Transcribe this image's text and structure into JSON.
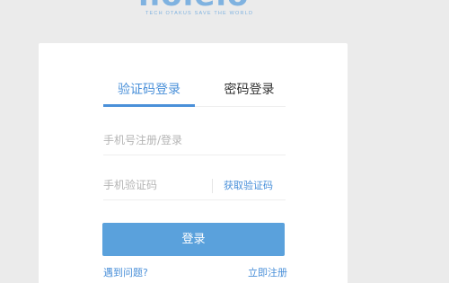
{
  "brand": {
    "logo_text": "ilolelo",
    "tagline": "TECH OTAKUS SAVE THE WORLD"
  },
  "login": {
    "tabs": [
      {
        "label": "验证码登录",
        "active": true
      },
      {
        "label": "密码登录",
        "active": false
      }
    ],
    "phone_placeholder": "手机号注册/登录",
    "code_placeholder": "手机验证码",
    "get_code_label": "获取验证码",
    "submit_label": "登录",
    "help_link": "遇到问题?",
    "register_link": "立即注册"
  },
  "colors": {
    "accent": "#4a90d9",
    "button": "#5aa1dc",
    "background": "#ebebeb"
  }
}
